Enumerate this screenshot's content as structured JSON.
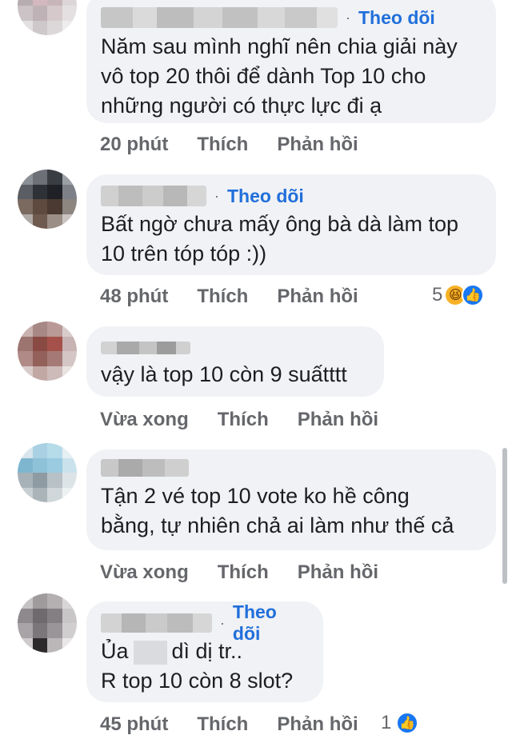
{
  "comments": [
    {
      "follow": "Theo dõi",
      "text": "Năm sau mình nghĩ nên chia giải này\nvô top 20 thôi để dành Top 10 cho\nnhững người có thực lực đi ạ",
      "time": "20 phút",
      "like": "Thích",
      "reply": "Phản hồi"
    },
    {
      "follow": "Theo dõi",
      "text": "Bất ngờ chưa mấy ông bà dà làm top\n10 trên tóp tóp :))",
      "time": "48 phút",
      "like": "Thích",
      "reply": "Phản hồi",
      "reaction_count": "5",
      "reactions": [
        "haha-icon",
        "like-icon"
      ]
    },
    {
      "text": "vậy là top 10 còn 9 suấtttt",
      "time": "Vừa xong",
      "like": "Thích",
      "reply": "Phản hồi"
    },
    {
      "text": "Tận 2 vé top 10 vote ko hề công\nbằng, tự nhiên chả ai làm như thế cả",
      "time": "Vừa xong",
      "like": "Thích",
      "reply": "Phản hồi"
    },
    {
      "follow": "Theo dõi",
      "text_part1": "Ủa",
      "text_part2": "dì dị tr..",
      "text_line2": "R top 10 còn 8 slot?",
      "time": "45 phút",
      "like": "Thích",
      "reply": "Phản hồi",
      "reaction_count": "1",
      "reactions": [
        "like-icon"
      ]
    }
  ],
  "colors": {
    "follow": "#216fdb",
    "bubble": "#f0f2f5",
    "meta": "#65676b"
  }
}
